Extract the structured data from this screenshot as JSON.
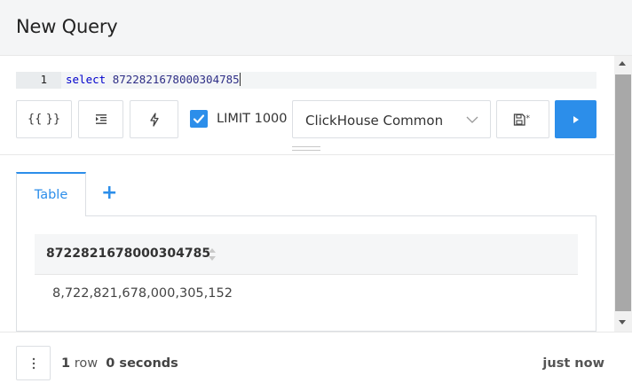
{
  "header": {
    "title": "New Query"
  },
  "editor": {
    "line_number": "1",
    "keyword": "select",
    "literal": "8722821678000304785"
  },
  "toolbar": {
    "format_label": "{{ }}",
    "format_icon": "braces-icon",
    "indent_icon": "indent-icon",
    "bolt_icon": "lightning-icon",
    "limit_checked": true,
    "limit_label": "LIMIT 1000",
    "connection_selected": "ClickHouse Common",
    "save_icon": "save-as-icon",
    "run_icon": "play-icon",
    "accent_color": "#2c8eea"
  },
  "tabs": {
    "active_label": "Table",
    "add_label": "+"
  },
  "results": {
    "columns": [
      "8722821678000304785"
    ],
    "rows": [
      [
        "8,722,821,678,000,305,152"
      ]
    ]
  },
  "footer": {
    "row_count": "1",
    "row_word": "row",
    "duration": "0 seconds",
    "time_ago": "just now"
  }
}
